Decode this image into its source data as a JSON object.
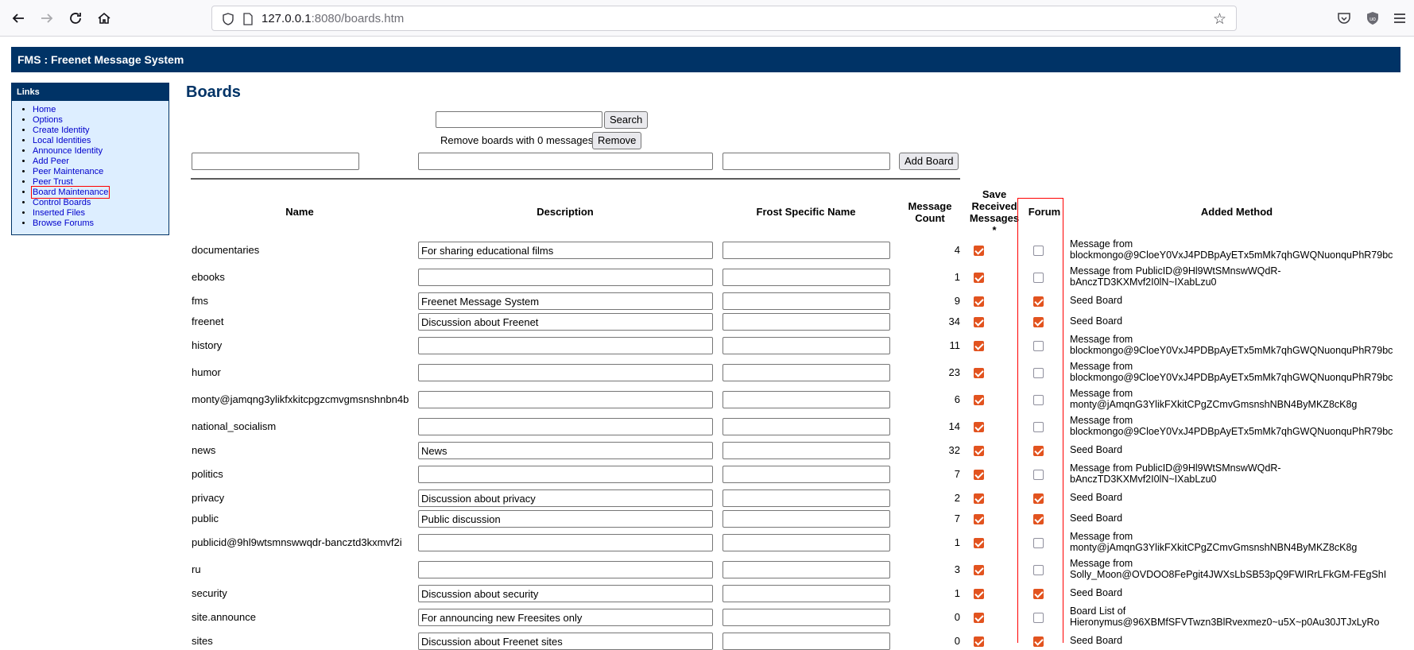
{
  "browser": {
    "url_host": "127.0.0.1",
    "url_rest": ":8080/boards.htm"
  },
  "banner": {
    "title": "FMS : Freenet Message System"
  },
  "sidebar": {
    "heading": "Links",
    "items": [
      {
        "label": "Home"
      },
      {
        "label": "Options"
      },
      {
        "label": "Create Identity"
      },
      {
        "label": "Local Identities"
      },
      {
        "label": "Announce Identity"
      },
      {
        "label": "Add Peer"
      },
      {
        "label": "Peer Maintenance"
      },
      {
        "label": "Peer Trust"
      },
      {
        "label": "Board Maintenance",
        "active": true
      },
      {
        "label": "Control Boards"
      },
      {
        "label": "Inserted Files"
      },
      {
        "label": "Browse Forums"
      }
    ]
  },
  "page": {
    "title": "Boards",
    "search_button": "Search",
    "remove_label": "Remove boards with 0 messages",
    "remove_button": "Remove",
    "add_button": "Add Board"
  },
  "table": {
    "headers": {
      "name": "Name",
      "description": "Description",
      "frost_name": "Frost Specific Name",
      "message_count": "Message Count",
      "save_received": "Save Received Messages *",
      "forum": "Forum",
      "added_method": "Added Method"
    },
    "rows": [
      {
        "name": "documentaries",
        "description": "For sharing educational films",
        "frost": "",
        "count": "4",
        "save": true,
        "forum": false,
        "method": [
          "Message from",
          "blockmongo@9CloeY0VxJ4PDBpAyETx5mMk7qhGWQNuonquPhR79bc"
        ]
      },
      {
        "name": "ebooks",
        "description": "",
        "frost": "",
        "count": "1",
        "save": true,
        "forum": false,
        "method": [
          "Message from PublicID@9Hl9WtSMnswWQdR-",
          "bAnczTD3KXMvf2I0lN~IXabLzu0"
        ]
      },
      {
        "name": "fms",
        "description": "Freenet Message System",
        "frost": "",
        "count": "9",
        "save": true,
        "forum": true,
        "method": [
          "Seed Board"
        ]
      },
      {
        "name": "freenet",
        "description": "Discussion about Freenet",
        "frost": "",
        "count": "34",
        "save": true,
        "forum": true,
        "method": [
          "Seed Board"
        ]
      },
      {
        "name": "history",
        "description": "",
        "frost": "",
        "count": "11",
        "save": true,
        "forum": false,
        "method": [
          "Message from",
          "blockmongo@9CloeY0VxJ4PDBpAyETx5mMk7qhGWQNuonquPhR79bc"
        ]
      },
      {
        "name": "humor",
        "description": "",
        "frost": "",
        "count": "23",
        "save": true,
        "forum": false,
        "method": [
          "Message from",
          "blockmongo@9CloeY0VxJ4PDBpAyETx5mMk7qhGWQNuonquPhR79bc"
        ]
      },
      {
        "name": "monty@jamqng3ylikfxkitcpgzcmvgmsnshnbn4b",
        "description": "",
        "frost": "",
        "count": "6",
        "save": true,
        "forum": false,
        "method": [
          "Message from",
          "monty@jAmqnG3YlikFXkitCPgZCmvGmsnshNBN4ByMKZ8cK8g"
        ]
      },
      {
        "name": "national_socialism",
        "description": "",
        "frost": "",
        "count": "14",
        "save": true,
        "forum": false,
        "method": [
          "Message from",
          "blockmongo@9CloeY0VxJ4PDBpAyETx5mMk7qhGWQNuonquPhR79bc"
        ]
      },
      {
        "name": "news",
        "description": "News",
        "frost": "",
        "count": "32",
        "save": true,
        "forum": true,
        "method": [
          "Seed Board"
        ]
      },
      {
        "name": "politics",
        "description": "",
        "frost": "",
        "count": "7",
        "save": true,
        "forum": false,
        "method": [
          "Message from PublicID@9Hl9WtSMnswWQdR-",
          "bAnczTD3KXMvf2I0lN~IXabLzu0"
        ]
      },
      {
        "name": "privacy",
        "description": "Discussion about privacy",
        "frost": "",
        "count": "2",
        "save": true,
        "forum": true,
        "method": [
          "Seed Board"
        ]
      },
      {
        "name": "public",
        "description": "Public discussion",
        "frost": "",
        "count": "7",
        "save": true,
        "forum": true,
        "method": [
          "Seed Board"
        ]
      },
      {
        "name": "publicid@9hl9wtsmnswwqdr-bancztd3kxmvf2i",
        "description": "",
        "frost": "",
        "count": "1",
        "save": true,
        "forum": false,
        "method": [
          "Message from",
          "monty@jAmqnG3YlikFXkitCPgZCmvGmsnshNBN4ByMKZ8cK8g"
        ]
      },
      {
        "name": "ru",
        "description": "",
        "frost": "",
        "count": "3",
        "save": true,
        "forum": false,
        "method": [
          "Message from",
          "Solly_Moon@OVDOO8FePgit4JWXsLbSB53pQ9FWIRrLFkGM-FEgShI"
        ]
      },
      {
        "name": "security",
        "description": "Discussion about security",
        "frost": "",
        "count": "1",
        "save": true,
        "forum": true,
        "method": [
          "Seed Board"
        ]
      },
      {
        "name": "site.announce",
        "description": "For announcing new Freesites only",
        "frost": "",
        "count": "0",
        "save": true,
        "forum": false,
        "method": [
          "Board List of",
          "Hieronymus@96XBMfSFVTwzn3BlRvexmez0~u5X~p0Au30JTJxLyRo"
        ]
      },
      {
        "name": "sites",
        "description": "Discussion about Freenet sites",
        "frost": "",
        "count": "0",
        "save": true,
        "forum": true,
        "method": [
          "Seed Board"
        ]
      }
    ]
  }
}
